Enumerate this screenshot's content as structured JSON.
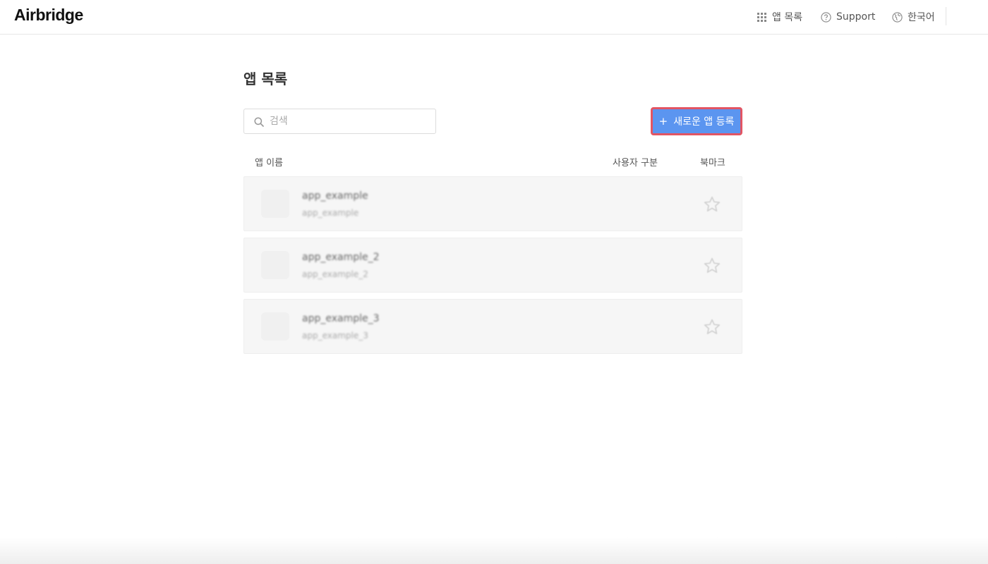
{
  "header": {
    "logo": "Airbridge",
    "nav": {
      "app_list": "앱 목록",
      "support": "Support",
      "language": "한국어"
    }
  },
  "main": {
    "title": "앱 목록",
    "search": {
      "placeholder": "검색",
      "value": ""
    },
    "new_app_button": {
      "icon": "+",
      "label": "새로운 앱 등록"
    },
    "columns": {
      "name": "앱 이름",
      "user_type": "사용자 구분",
      "bookmark": "북마크"
    },
    "apps": [
      {
        "name": "app_example",
        "subtitle": "app_example"
      },
      {
        "name": "app_example_2",
        "subtitle": "app_example_2"
      },
      {
        "name": "app_example_3",
        "subtitle": "app_example_3"
      }
    ]
  },
  "colors": {
    "primary_button": "#5b95f0",
    "highlight_border": "#e25563"
  }
}
